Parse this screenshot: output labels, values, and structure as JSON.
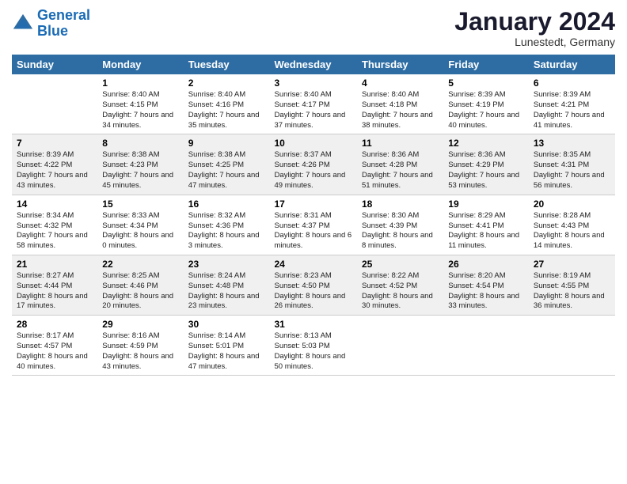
{
  "header": {
    "logo_line1": "General",
    "logo_line2": "Blue",
    "month": "January 2024",
    "location": "Lunestedt, Germany"
  },
  "columns": [
    "Sunday",
    "Monday",
    "Tuesday",
    "Wednesday",
    "Thursday",
    "Friday",
    "Saturday"
  ],
  "weeks": [
    [
      {
        "day": "",
        "sunrise": "",
        "sunset": "",
        "daylight": ""
      },
      {
        "day": "1",
        "sunrise": "Sunrise: 8:40 AM",
        "sunset": "Sunset: 4:15 PM",
        "daylight": "Daylight: 7 hours and 34 minutes."
      },
      {
        "day": "2",
        "sunrise": "Sunrise: 8:40 AM",
        "sunset": "Sunset: 4:16 PM",
        "daylight": "Daylight: 7 hours and 35 minutes."
      },
      {
        "day": "3",
        "sunrise": "Sunrise: 8:40 AM",
        "sunset": "Sunset: 4:17 PM",
        "daylight": "Daylight: 7 hours and 37 minutes."
      },
      {
        "day": "4",
        "sunrise": "Sunrise: 8:40 AM",
        "sunset": "Sunset: 4:18 PM",
        "daylight": "Daylight: 7 hours and 38 minutes."
      },
      {
        "day": "5",
        "sunrise": "Sunrise: 8:39 AM",
        "sunset": "Sunset: 4:19 PM",
        "daylight": "Daylight: 7 hours and 40 minutes."
      },
      {
        "day": "6",
        "sunrise": "Sunrise: 8:39 AM",
        "sunset": "Sunset: 4:21 PM",
        "daylight": "Daylight: 7 hours and 41 minutes."
      }
    ],
    [
      {
        "day": "7",
        "sunrise": "Sunrise: 8:39 AM",
        "sunset": "Sunset: 4:22 PM",
        "daylight": "Daylight: 7 hours and 43 minutes."
      },
      {
        "day": "8",
        "sunrise": "Sunrise: 8:38 AM",
        "sunset": "Sunset: 4:23 PM",
        "daylight": "Daylight: 7 hours and 45 minutes."
      },
      {
        "day": "9",
        "sunrise": "Sunrise: 8:38 AM",
        "sunset": "Sunset: 4:25 PM",
        "daylight": "Daylight: 7 hours and 47 minutes."
      },
      {
        "day": "10",
        "sunrise": "Sunrise: 8:37 AM",
        "sunset": "Sunset: 4:26 PM",
        "daylight": "Daylight: 7 hours and 49 minutes."
      },
      {
        "day": "11",
        "sunrise": "Sunrise: 8:36 AM",
        "sunset": "Sunset: 4:28 PM",
        "daylight": "Daylight: 7 hours and 51 minutes."
      },
      {
        "day": "12",
        "sunrise": "Sunrise: 8:36 AM",
        "sunset": "Sunset: 4:29 PM",
        "daylight": "Daylight: 7 hours and 53 minutes."
      },
      {
        "day": "13",
        "sunrise": "Sunrise: 8:35 AM",
        "sunset": "Sunset: 4:31 PM",
        "daylight": "Daylight: 7 hours and 56 minutes."
      }
    ],
    [
      {
        "day": "14",
        "sunrise": "Sunrise: 8:34 AM",
        "sunset": "Sunset: 4:32 PM",
        "daylight": "Daylight: 7 hours and 58 minutes."
      },
      {
        "day": "15",
        "sunrise": "Sunrise: 8:33 AM",
        "sunset": "Sunset: 4:34 PM",
        "daylight": "Daylight: 8 hours and 0 minutes."
      },
      {
        "day": "16",
        "sunrise": "Sunrise: 8:32 AM",
        "sunset": "Sunset: 4:36 PM",
        "daylight": "Daylight: 8 hours and 3 minutes."
      },
      {
        "day": "17",
        "sunrise": "Sunrise: 8:31 AM",
        "sunset": "Sunset: 4:37 PM",
        "daylight": "Daylight: 8 hours and 6 minutes."
      },
      {
        "day": "18",
        "sunrise": "Sunrise: 8:30 AM",
        "sunset": "Sunset: 4:39 PM",
        "daylight": "Daylight: 8 hours and 8 minutes."
      },
      {
        "day": "19",
        "sunrise": "Sunrise: 8:29 AM",
        "sunset": "Sunset: 4:41 PM",
        "daylight": "Daylight: 8 hours and 11 minutes."
      },
      {
        "day": "20",
        "sunrise": "Sunrise: 8:28 AM",
        "sunset": "Sunset: 4:43 PM",
        "daylight": "Daylight: 8 hours and 14 minutes."
      }
    ],
    [
      {
        "day": "21",
        "sunrise": "Sunrise: 8:27 AM",
        "sunset": "Sunset: 4:44 PM",
        "daylight": "Daylight: 8 hours and 17 minutes."
      },
      {
        "day": "22",
        "sunrise": "Sunrise: 8:25 AM",
        "sunset": "Sunset: 4:46 PM",
        "daylight": "Daylight: 8 hours and 20 minutes."
      },
      {
        "day": "23",
        "sunrise": "Sunrise: 8:24 AM",
        "sunset": "Sunset: 4:48 PM",
        "daylight": "Daylight: 8 hours and 23 minutes."
      },
      {
        "day": "24",
        "sunrise": "Sunrise: 8:23 AM",
        "sunset": "Sunset: 4:50 PM",
        "daylight": "Daylight: 8 hours and 26 minutes."
      },
      {
        "day": "25",
        "sunrise": "Sunrise: 8:22 AM",
        "sunset": "Sunset: 4:52 PM",
        "daylight": "Daylight: 8 hours and 30 minutes."
      },
      {
        "day": "26",
        "sunrise": "Sunrise: 8:20 AM",
        "sunset": "Sunset: 4:54 PM",
        "daylight": "Daylight: 8 hours and 33 minutes."
      },
      {
        "day": "27",
        "sunrise": "Sunrise: 8:19 AM",
        "sunset": "Sunset: 4:55 PM",
        "daylight": "Daylight: 8 hours and 36 minutes."
      }
    ],
    [
      {
        "day": "28",
        "sunrise": "Sunrise: 8:17 AM",
        "sunset": "Sunset: 4:57 PM",
        "daylight": "Daylight: 8 hours and 40 minutes."
      },
      {
        "day": "29",
        "sunrise": "Sunrise: 8:16 AM",
        "sunset": "Sunset: 4:59 PM",
        "daylight": "Daylight: 8 hours and 43 minutes."
      },
      {
        "day": "30",
        "sunrise": "Sunrise: 8:14 AM",
        "sunset": "Sunset: 5:01 PM",
        "daylight": "Daylight: 8 hours and 47 minutes."
      },
      {
        "day": "31",
        "sunrise": "Sunrise: 8:13 AM",
        "sunset": "Sunset: 5:03 PM",
        "daylight": "Daylight: 8 hours and 50 minutes."
      },
      {
        "day": "",
        "sunrise": "",
        "sunset": "",
        "daylight": ""
      },
      {
        "day": "",
        "sunrise": "",
        "sunset": "",
        "daylight": ""
      },
      {
        "day": "",
        "sunrise": "",
        "sunset": "",
        "daylight": ""
      }
    ]
  ]
}
